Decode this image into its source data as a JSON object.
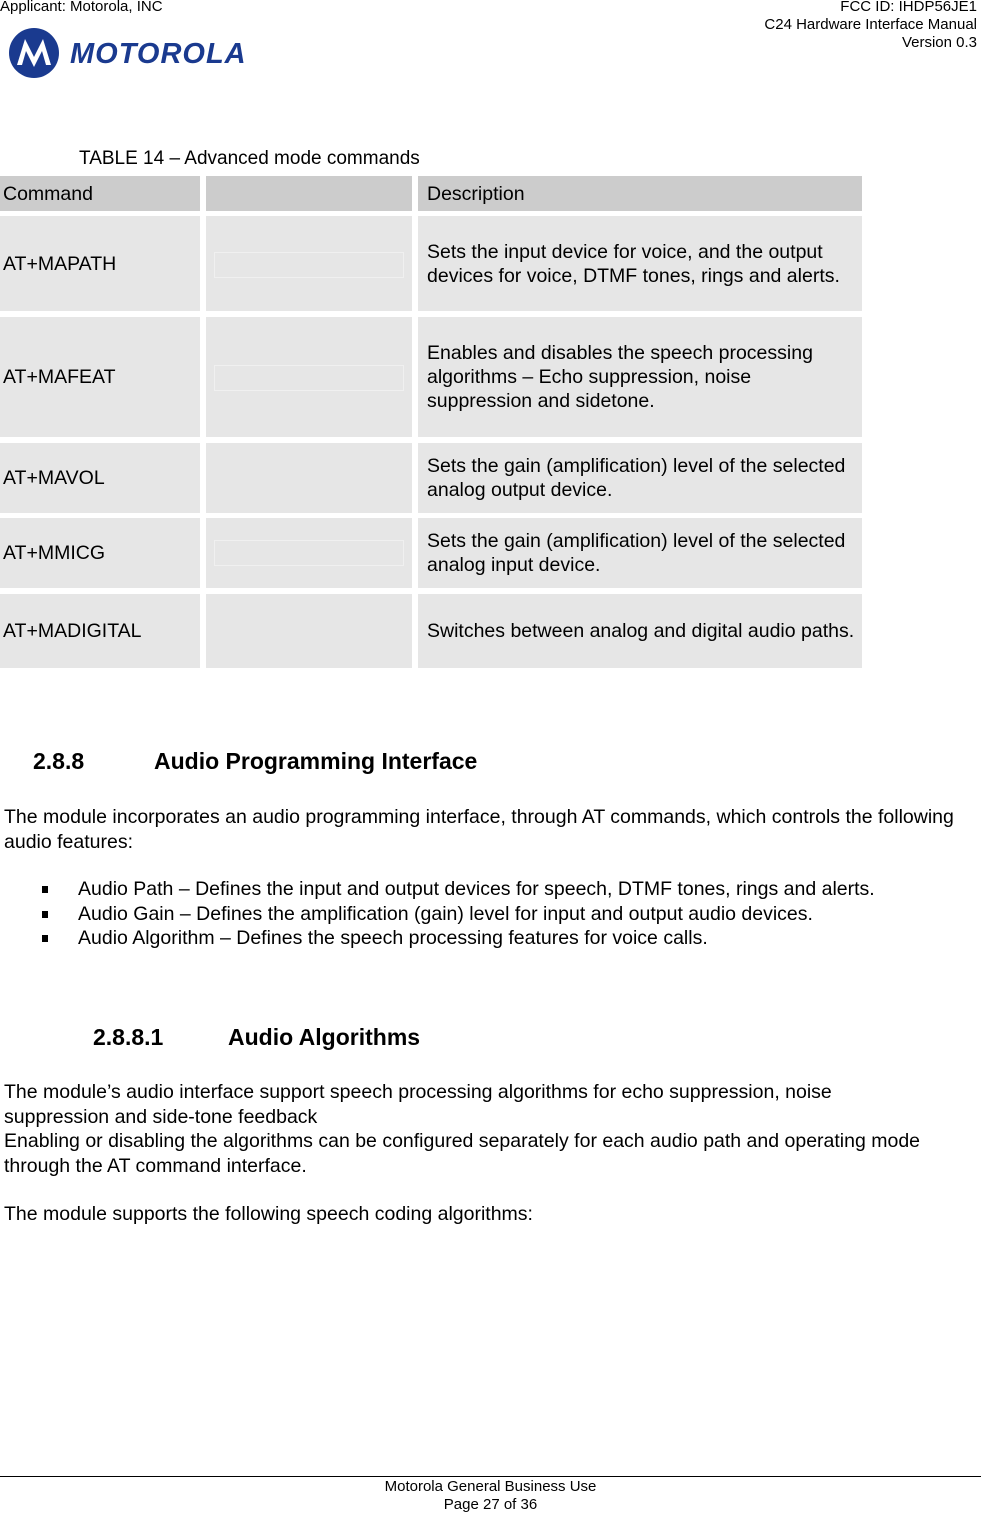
{
  "header": {
    "applicant": "Applicant: Motorola, INC",
    "fcc_id": "FCC ID: IHDP56JE1",
    "manual_title": "C24 Hardware Interface Manual",
    "version": "Version 0.3",
    "logo_text": "MOTOROLA",
    "brand_color": "#1a3a8f"
  },
  "table": {
    "caption": "TABLE 14 – Advanced mode commands",
    "columns": [
      "Command",
      "",
      "Description"
    ],
    "rows": [
      {
        "command": "AT+MAPATH",
        "extra": "",
        "description": "Sets the input device for voice, and the output devices for voice, DTMF tones, rings and alerts."
      },
      {
        "command": "AT+MAFEAT",
        "extra": "",
        "description": "Enables and disables the speech processing algorithms – Echo suppression, noise suppression and sidetone."
      },
      {
        "command": "AT+MAVOL",
        "extra": "",
        "description": "Sets the gain (amplification) level of the selected analog output device."
      },
      {
        "command": "AT+MMICG",
        "extra": "",
        "description": "Sets the gain (amplification) level of the selected analog input device."
      },
      {
        "command": "AT+MADIGITAL",
        "extra": "",
        "description": "Switches between analog and digital audio paths."
      }
    ]
  },
  "section_288": {
    "number": "2.8.8",
    "title": "Audio Programming Interface",
    "intro": "The module incorporates an audio programming interface, through AT commands, which controls the following audio features:",
    "bullets": [
      "Audio Path – Defines the input and output devices for speech, DTMF tones, rings and alerts.",
      "Audio Gain – Defines the amplification (gain) level for input and output audio devices.",
      "Audio Algorithm – Defines the speech processing features for voice calls."
    ]
  },
  "section_2881": {
    "number": "2.8.8.1",
    "title": "Audio Algorithms",
    "para1_line1": "The module’s audio interface support speech processing algorithms for echo suppression, noise suppression and side-tone feedback",
    "para1_line2": "Enabling or disabling the algorithms can be configured separately for each audio path and operating mode through the AT command interface.",
    "para2": "The module supports the following speech coding algorithms:"
  },
  "footer": {
    "classification": "Motorola General Business Use",
    "page": "Page 27 of 36"
  }
}
